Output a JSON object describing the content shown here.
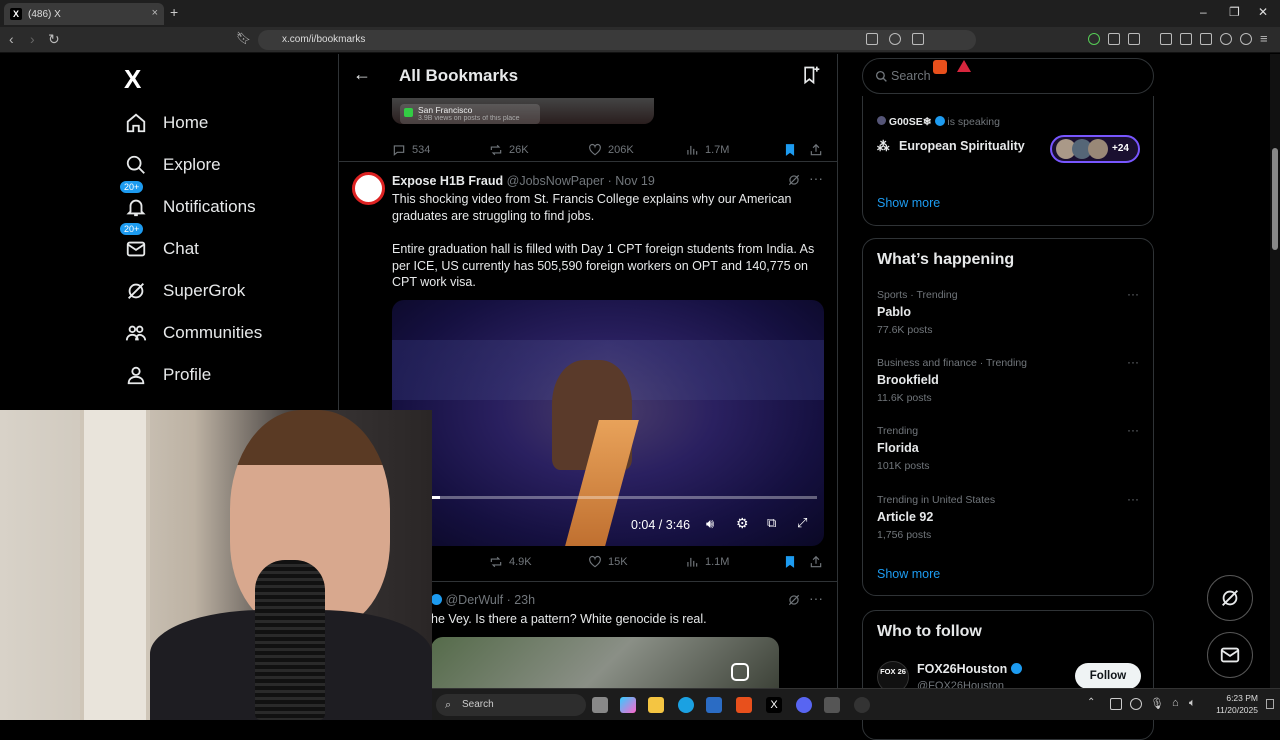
{
  "browser": {
    "tab_title": "(486) X",
    "tab_close": "×",
    "new_tab": "+",
    "url": "x.com/i/bookmarks"
  },
  "nav": {
    "logo": "X",
    "items": [
      {
        "label": "Home",
        "icon": "home-icon"
      },
      {
        "label": "Explore",
        "icon": "search-icon"
      },
      {
        "label": "Notifications",
        "icon": "bell-icon",
        "badge": "20+"
      },
      {
        "label": "Chat",
        "icon": "mail-icon",
        "badge": "20+"
      },
      {
        "label": "SuperGrok",
        "icon": "grok-icon"
      },
      {
        "label": "Communities",
        "icon": "people-icon"
      },
      {
        "label": "Profile",
        "icon": "person-icon"
      }
    ]
  },
  "main": {
    "title": "All Bookmarks",
    "prev_tweet": {
      "location": "San Francisco",
      "location_sub": "3.9B views on posts of this place",
      "replies": "534",
      "reposts": "26K",
      "likes": "206K",
      "views": "1.7M"
    },
    "tweet": {
      "author": "Expose H1B Fraud",
      "handle": "@JobsNowPaper",
      "date": "· Nov 19",
      "text1": "This shocking video from St. Francis College explains why our American graduates are struggling to find jobs.",
      "text2": "Entire graduation hall is filled with Day 1 CPT foreign students from India. As per ICE, US currently has 505,590 foreign workers on OPT and 140,775 on CPT work visa.",
      "video_time": "0:04 / 3:46",
      "video_progress": 0.02,
      "reposts": "4.9K",
      "likes": "15K",
      "views": "1.1M"
    },
    "tweet2": {
      "handle": "@DerWulf",
      "date": "· 23h",
      "text": "he Vey. Is there a pattern? White genocide is real."
    }
  },
  "right": {
    "search_placeholder": "Search",
    "space": {
      "host": "G00SE❄",
      "status": "is speaking",
      "title": "European Spirituality",
      "listeners": "+24",
      "show_more": "Show more"
    },
    "happening": {
      "title": "What’s happening",
      "trends": [
        {
          "category": "Sports · Trending",
          "name": "Pablo",
          "posts": "77.6K posts"
        },
        {
          "category": "Business and finance · Trending",
          "name": "Brookfield",
          "posts": "11.6K posts"
        },
        {
          "category": "Trending",
          "name": "Florida",
          "posts": "101K posts"
        },
        {
          "category": "Trending in United States",
          "name": "Article 92",
          "posts": "1,756 posts"
        }
      ],
      "show_more": "Show more"
    },
    "who_to_follow": {
      "title": "Who to follow",
      "name": "FOX26Houston",
      "handle": "@FOX26Houston",
      "follow": "Follow",
      "avatar_text": "FOX 26"
    }
  },
  "taskbar": {
    "search_placeholder": "Search",
    "time": "6:23 PM",
    "date": "11/20/2025"
  },
  "colors": {
    "accent": "#1d9bf0",
    "background": "#000000",
    "border": "#2f3336",
    "muted": "#71767b"
  }
}
